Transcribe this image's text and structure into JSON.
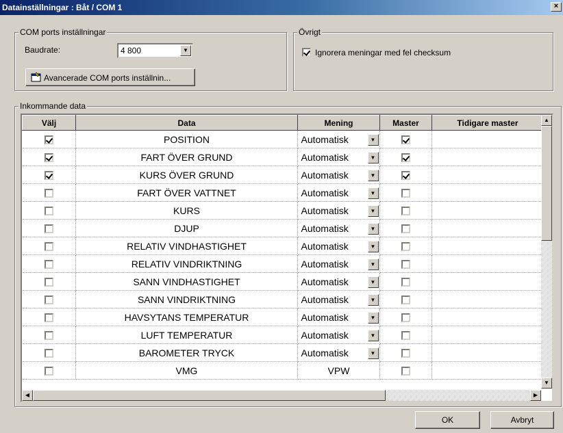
{
  "window": {
    "title": "Datainställningar  :  Båt / COM 1",
    "close": "×"
  },
  "com_group": {
    "label": "COM ports inställningar",
    "baudrate_label": "Baudrate:",
    "baudrate_value": "4 800",
    "advanced_button": "Avancerade COM ports inställnin..."
  },
  "other_group": {
    "label": "Övrigt",
    "ignore_checksum_label": "Ignorera meningar med fel checksum",
    "ignore_checksum_checked": true
  },
  "incoming": {
    "label": "Inkommande data",
    "columns": [
      "Välj",
      "Data",
      "Mening",
      "Master",
      "Tidigare master"
    ],
    "rows": [
      {
        "select": true,
        "data": "POSITION",
        "mening": "Automatisk",
        "dropdown": true,
        "master": true
      },
      {
        "select": true,
        "data": "FART ÖVER GRUND",
        "mening": "Automatisk",
        "dropdown": true,
        "master": true
      },
      {
        "select": true,
        "data": "KURS ÖVER GRUND",
        "mening": "Automatisk",
        "dropdown": true,
        "master": true
      },
      {
        "select": false,
        "data": "FART ÖVER VATTNET",
        "mening": "Automatisk",
        "dropdown": true,
        "master": false
      },
      {
        "select": false,
        "data": "KURS",
        "mening": "Automatisk",
        "dropdown": true,
        "master": false
      },
      {
        "select": false,
        "data": "DJUP",
        "mening": "Automatisk",
        "dropdown": true,
        "master": false
      },
      {
        "select": false,
        "data": "RELATIV VINDHASTIGHET",
        "mening": "Automatisk",
        "dropdown": true,
        "master": false
      },
      {
        "select": false,
        "data": "RELATIV VINDRIKTNING",
        "mening": "Automatisk",
        "dropdown": true,
        "master": false
      },
      {
        "select": false,
        "data": "SANN VINDHASTIGHET",
        "mening": "Automatisk",
        "dropdown": true,
        "master": false
      },
      {
        "select": false,
        "data": "SANN VINDRIKTNING",
        "mening": "Automatisk",
        "dropdown": true,
        "master": false
      },
      {
        "select": false,
        "data": "HAVSYTANS TEMPERATUR",
        "mening": "Automatisk",
        "dropdown": true,
        "master": false
      },
      {
        "select": false,
        "data": "LUFT TEMPERATUR",
        "mening": "Automatisk",
        "dropdown": true,
        "master": false
      },
      {
        "select": false,
        "data": "BAROMETER TRYCK",
        "mening": "Automatisk",
        "dropdown": true,
        "master": false
      },
      {
        "select": false,
        "data": "VMG",
        "mening": "VPW",
        "dropdown": false,
        "master": false
      }
    ]
  },
  "buttons": {
    "ok": "OK",
    "cancel": "Avbryt"
  },
  "colors": {
    "title_start": "#0a246a",
    "title_end": "#a6caf0",
    "face": "#d4d0c8"
  }
}
